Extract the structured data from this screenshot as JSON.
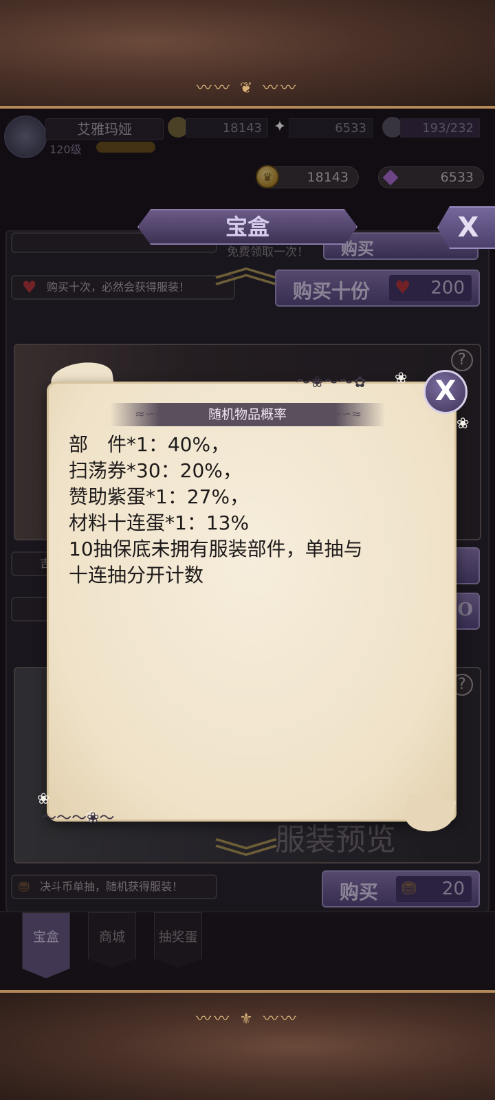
{
  "player": {
    "name": "艾雅玛娅",
    "level": "120级",
    "res_gold": "18143",
    "res_star": "6533",
    "res_stamina": "193/232"
  },
  "currency": {
    "gold": "18143",
    "gem": "6533",
    "gold_icon": "crown-coin-icon",
    "gem_icon": "purple-diamond-icon"
  },
  "header": {
    "title": "宝盒",
    "close_label": "X"
  },
  "shop": {
    "free_hint": "免费领取一次！",
    "buy_label": "购买",
    "tip_ten": "购买十次，必然会获得服装！",
    "buy_ten_label": "购买十份",
    "buy_ten_cost": "200",
    "preview_text": "服装预览",
    "tip_duel": "决斗币单抽，随机获得服装！",
    "buy_duel_label": "购买",
    "buy_duel_cost": "20",
    "help_label": "?",
    "row_hint_1": "吉",
    "row_hint_2": "O"
  },
  "tabs": [
    {
      "label": "宝盒",
      "active": true
    },
    {
      "label": "商城",
      "active": false
    },
    {
      "label": "抽奖蛋",
      "active": false
    }
  ],
  "modal": {
    "title": "随机物品概率",
    "close_label": "X",
    "lines": [
      "部　件*1：40%，",
      "扫荡券*30：20%，",
      "赞助紫蛋*1：27%，",
      "材料十连蛋*1：13%",
      "10抽保底未拥有服装部件，单抽与",
      "十连抽分开计数"
    ]
  },
  "colors": {
    "accent_purple": "#6a5a86",
    "heart_red": "#b8383e",
    "gold_trim": "#b48a5a",
    "parchment": "#f6eddc"
  }
}
